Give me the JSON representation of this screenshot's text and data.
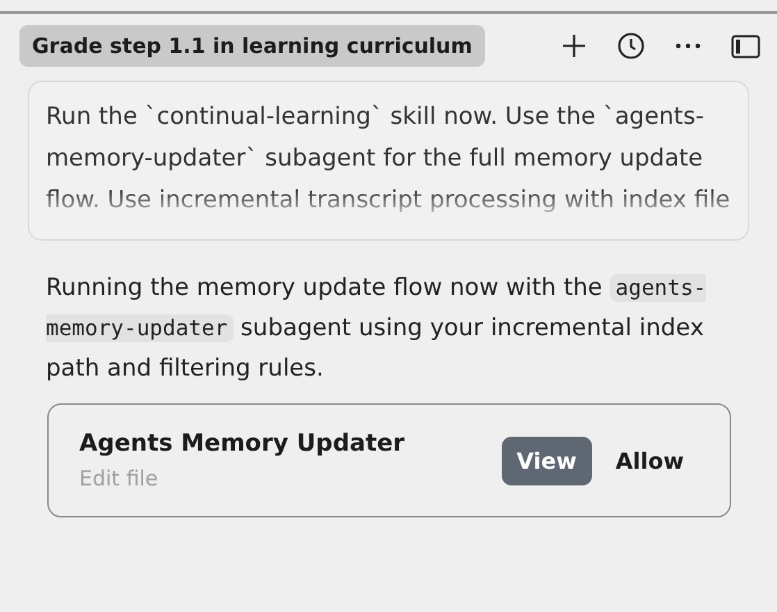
{
  "header": {
    "title": "Grade step 1.1 in learning curriculum"
  },
  "user_message": {
    "text": "Run the `continual-learning` skill now. Use the `agents-memory-updater` subagent for the full memory update flow. Use incremental transcript processing with index file"
  },
  "assistant_message": {
    "segments": [
      {
        "kind": "text",
        "text": "Running the memory update flow now with the "
      },
      {
        "kind": "code",
        "text": "agents-memory-updater"
      },
      {
        "kind": "text",
        "text": " subagent using your incremental index path and filtering rules."
      }
    ]
  },
  "approval_card": {
    "title": "Agents Memory Updater",
    "subtitle": "Edit file",
    "buttons": [
      {
        "label": "View",
        "kind": "primary"
      },
      {
        "label": "Allow",
        "kind": "plain"
      }
    ]
  }
}
